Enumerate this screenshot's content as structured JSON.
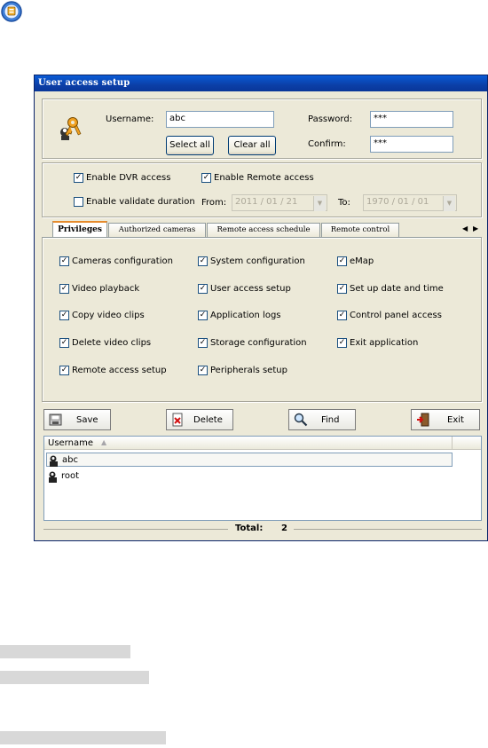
{
  "window": {
    "title": "User access setup"
  },
  "user": {
    "username_label": "Username:",
    "username_value": "abc",
    "password_label": "Password:",
    "password_value": "***",
    "confirm_label": "Confirm:",
    "confirm_value": "***",
    "select_all": "Select all",
    "clear_all": "Clear all"
  },
  "access": {
    "enable_dvr": "Enable DVR access",
    "enable_dvr_checked": true,
    "enable_remote": "Enable Remote access",
    "enable_remote_checked": true,
    "enable_validate": "Enable validate duration",
    "enable_validate_checked": false,
    "from_label": "From:",
    "from_value": "2011 / 01 / 21",
    "to_label": "To:",
    "to_value": "1970 / 01 / 01"
  },
  "tabs": [
    "Privileges",
    "Authorized cameras",
    "Remote access schedule",
    "Remote control"
  ],
  "privileges": {
    "col1": [
      "Cameras configuration",
      "Video playback",
      "Copy video clips",
      "Delete video clips",
      "Remote access setup"
    ],
    "col2": [
      "System configuration",
      "User access setup",
      "Application logs",
      "Storage configuration",
      "Peripherals setup"
    ],
    "col3": [
      "eMap",
      "Set up date and time",
      "Control panel access",
      "Exit application"
    ]
  },
  "toolbar": {
    "save": "Save",
    "delete": "Delete",
    "find": "Find",
    "exit": "Exit"
  },
  "list": {
    "header": "Username",
    "rows": [
      "abc",
      "root"
    ]
  },
  "footer": {
    "total_label": "Total:",
    "total_value": "2"
  },
  "colors": {
    "titlebar": "#0a3698",
    "window_bg": "#ece9d8",
    "tab_highlight": "#e68b2c"
  }
}
